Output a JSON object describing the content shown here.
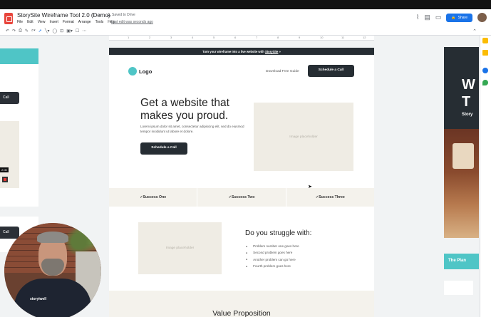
{
  "doc": {
    "title": "StorySite Wireframe Tool 2.0 (Demo)",
    "saved": "Saved to Drive",
    "last_edit": "Last edit was seconds ago",
    "share_label": "Share"
  },
  "menu": [
    "File",
    "Edit",
    "View",
    "Insert",
    "Format",
    "Arrange",
    "Tools",
    "Help"
  ],
  "ruler_ticks": [
    "1",
    "2",
    "3",
    "4",
    "5",
    "6",
    "7",
    "8",
    "9",
    "10",
    "11",
    "12"
  ],
  "left_slide": {
    "button_label": "Call",
    "timer": "2:00",
    "button2_label": "Call"
  },
  "webcam": {
    "shirt_text": "storyiwell"
  },
  "slide": {
    "banner_text": "Turn your wireframe into a live website with",
    "banner_link": "StorySite",
    "banner_arrow": "»",
    "logo": "Logo",
    "download_link": "Download Free Guide",
    "cta_top": "Schedule a Call",
    "headline": "Get a website that makes you proud.",
    "subtext": "Lorem ipsum dolor sit amet, consectetur adipiscing elit, sed do eiusmod tempor incididunt ut labore et dolore.",
    "cta_hero": "Schedule a Call",
    "hero_image": "Image placeholder",
    "successes": [
      "✓Success One",
      "✓Success Two",
      "✓Success Three"
    ],
    "struggle_image": "Image placeholder",
    "struggle_title": "Do you struggle with:",
    "problems": [
      "Problem number one goes here",
      "Second problem goes here",
      "Another problem can go here",
      "Fourth problem goes here"
    ],
    "value_title": "Value Proposition"
  },
  "right_slide": {
    "word1": "W",
    "word2": "T",
    "story": "Story",
    "plan_label": "The Plan"
  },
  "colors": {
    "accent_teal": "#4fc5c6",
    "dark_button": "#262d33",
    "share_blue": "#1a73e8",
    "band_beige": "#f4f2ec"
  }
}
